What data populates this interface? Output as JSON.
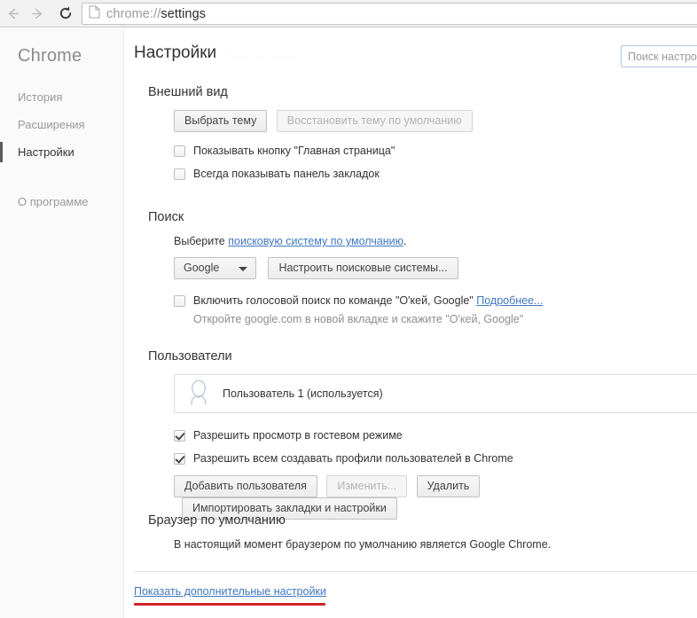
{
  "browser": {
    "url_scheme": "chrome://",
    "url_path": "settings",
    "url_full": "chrome://settings",
    "back_icon": "back-arrow-icon",
    "forward_icon": "forward-arrow-icon",
    "reload_icon": "reload-icon",
    "page_icon": "page-document-icon"
  },
  "sidebar": {
    "brand": "Chrome",
    "items": [
      {
        "label": "История",
        "active": false
      },
      {
        "label": "Расширения",
        "active": false
      },
      {
        "label": "Настройки",
        "active": true
      },
      {
        "label": "О программе",
        "active": false
      }
    ]
  },
  "header": {
    "title": "Настройки",
    "ghost_text": "Поиск настроек",
    "search_placeholder": "Поиск настроек",
    "search_visible_text": "Поиск настро"
  },
  "appearance": {
    "title": "Внешний вид",
    "choose_theme_button": "Выбрать тему",
    "reset_theme_button": "Восстановить тему по умолчанию",
    "reset_theme_disabled": true,
    "checkboxes": [
      {
        "label": "Показывать кнопку \"Главная страница\"",
        "checked": false
      },
      {
        "label": "Всегда показывать панель закладок",
        "checked": false
      }
    ]
  },
  "search_section": {
    "title": "Поиск",
    "choose_prefix": "Выберите ",
    "choose_link": "поисковую систему по умолчанию",
    "choose_suffix": ".",
    "engine_selected": "Google",
    "manage_button": "Настроить поисковые системы...",
    "voice_checkbox_label": "Включить голосовой поиск по команде \"О'кей, Google\"",
    "voice_checked": false,
    "voice_more_link": "Подробнее...",
    "voice_note": "Откройте google.com в новой вкладке и скажите \"О'кей, Google\""
  },
  "users": {
    "title": "Пользователи",
    "avatar_icon": "person-silhouette-icon",
    "current_user": "Пользователь 1 (используется)",
    "checkboxes": [
      {
        "label": "Разрешить просмотр в гостевом режиме",
        "checked": true
      },
      {
        "label": "Разрешить всем создавать профили пользователей в Chrome",
        "checked": true
      }
    ],
    "buttons": [
      {
        "label": "Добавить пользователя",
        "disabled": false
      },
      {
        "label": "Изменить...",
        "disabled": true
      },
      {
        "label": "Удалить",
        "disabled": false
      },
      {
        "label": "Импортировать закладки и настройки",
        "disabled": false
      }
    ]
  },
  "default_browser": {
    "title": "Браузер по умолчанию",
    "status": "В настоящий момент браузером по умолчанию является Google Chrome."
  },
  "footer": {
    "advanced_link": "Показать дополнительные настройки",
    "annotation_color": "#d0232b"
  }
}
